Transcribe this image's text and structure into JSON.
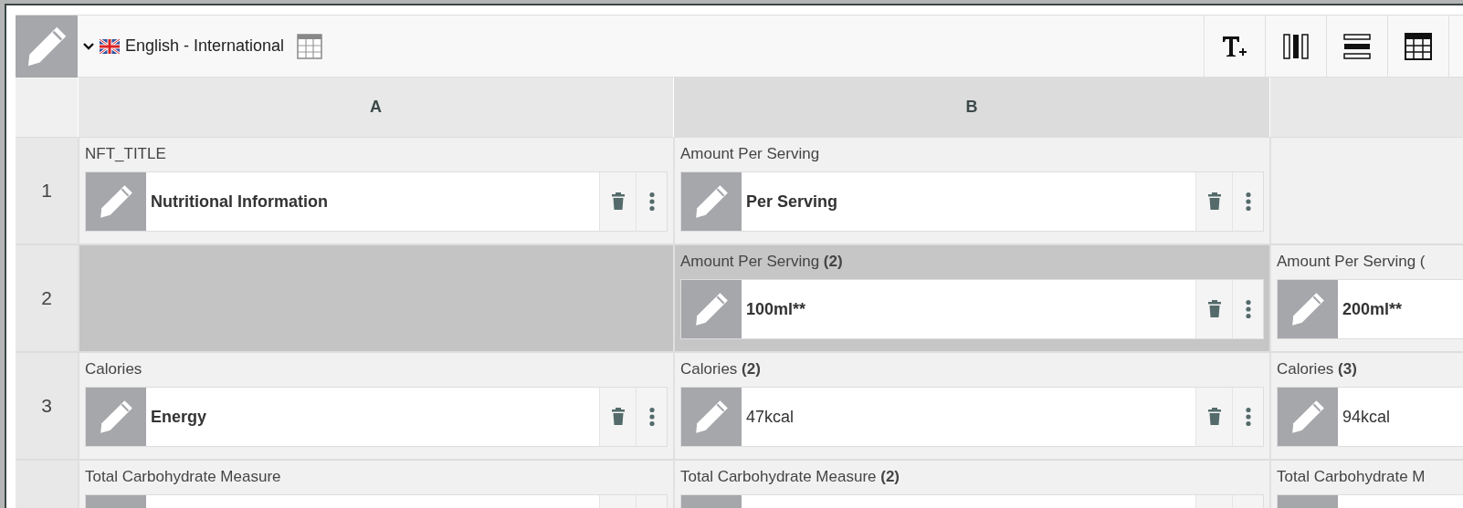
{
  "toolbar": {
    "language": "English - International",
    "tools": [
      {
        "kind": "text-add"
      },
      {
        "kind": "columns"
      },
      {
        "kind": "rows"
      },
      {
        "kind": "table"
      }
    ]
  },
  "columns": [
    {
      "label": "A",
      "selected": false
    },
    {
      "label": "B",
      "selected": true
    },
    {
      "selected": false
    }
  ],
  "rows": [
    {
      "number": "1",
      "cells": [
        {
          "kind": "field",
          "label": "NFT_TITLE",
          "value": "Nutritional Information",
          "bold": true,
          "actions": true,
          "selected": false
        },
        {
          "kind": "field",
          "label": "Amount Per Serving",
          "value": "Per Serving",
          "bold": true,
          "actions": true,
          "selected": false
        },
        {
          "kind": "empty",
          "selected": false
        }
      ]
    },
    {
      "number": "2",
      "cells": [
        {
          "kind": "empty",
          "selected": true
        },
        {
          "kind": "field",
          "label": "Amount Per Serving **(2)**",
          "value": "100ml**",
          "bold": true,
          "actions": true,
          "selected": true
        },
        {
          "kind": "field",
          "label": "Amount Per Serving (",
          "value": "200ml**",
          "bold": true,
          "selected": false
        }
      ]
    },
    {
      "number": "3",
      "cells": [
        {
          "kind": "field",
          "label": "Calories",
          "value": "Energy",
          "bold": true,
          "actions": true,
          "selected": false
        },
        {
          "kind": "field",
          "label": "Calories **(2)**",
          "value": "47kcal",
          "bold": false,
          "actions": true,
          "selected": false
        },
        {
          "kind": "field",
          "label": "Calories **(3)**",
          "value": "94kcal",
          "bold": false,
          "selected": false
        }
      ]
    },
    {
      "cells": [
        {
          "kind": "field",
          "label": "Total Carbohydrate Measure",
          "actions": true,
          "selected": false
        },
        {
          "kind": "field",
          "label": "Total Carbohydrate Measure **(2)**",
          "actions": true,
          "selected": false
        },
        {
          "kind": "field",
          "label": "Total Carbohydrate M",
          "selected": false
        }
      ]
    }
  ]
}
